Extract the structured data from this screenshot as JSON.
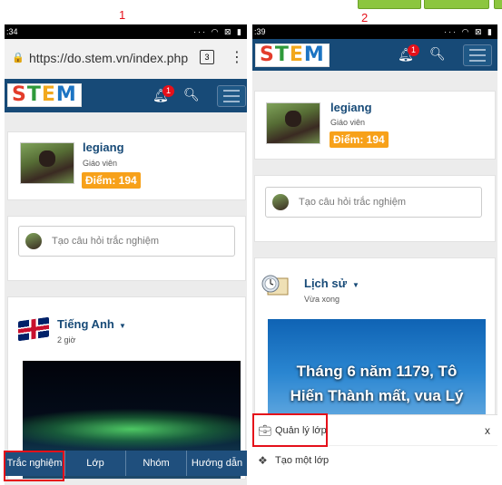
{
  "steps": [
    "1",
    "2"
  ],
  "phone1": {
    "status_time": ":34",
    "browser": {
      "url": "https://do.stem.vn/index.php",
      "tab_count": "3",
      "more": "⋮",
      "lock": "🔒"
    },
    "header": {
      "logo_letters": [
        "S",
        "T",
        "E",
        "M"
      ],
      "notification_count": "1"
    },
    "profile": {
      "name": "legiang",
      "role": "Giáo viên",
      "points": "Điểm: 194"
    },
    "question_placeholder": "Tạo câu hỏi trắc nghiệm",
    "post": {
      "subject": "Tiếng Anh",
      "time": "2 giờ"
    },
    "bottom_nav": [
      "Trắc nghiệm",
      "Lớp",
      "Nhóm",
      "Hướng dẫn"
    ]
  },
  "phone2": {
    "status_time": ":39",
    "header": {
      "logo_letters": [
        "S",
        "T",
        "E",
        "M"
      ],
      "notification_count": "1"
    },
    "profile": {
      "name": "legiang",
      "role": "Giáo viên",
      "points": "Điểm: 194"
    },
    "question_placeholder": "Tạo câu hỏi trắc nghiệm",
    "post": {
      "subject": "Lịch sử",
      "time": "Vừa xong",
      "caption_line1": "Tháng 6 năm 1179, Tô",
      "caption_line2": "Hiến Thành mất, vua Lý"
    },
    "sheet": {
      "manage_class": "Quản lý lớp",
      "create_class": "Tạo một lớp",
      "close": "x"
    }
  },
  "colors": {
    "accent": "#174a77",
    "highlight": "#e5101a",
    "points": "#f7a11a"
  }
}
